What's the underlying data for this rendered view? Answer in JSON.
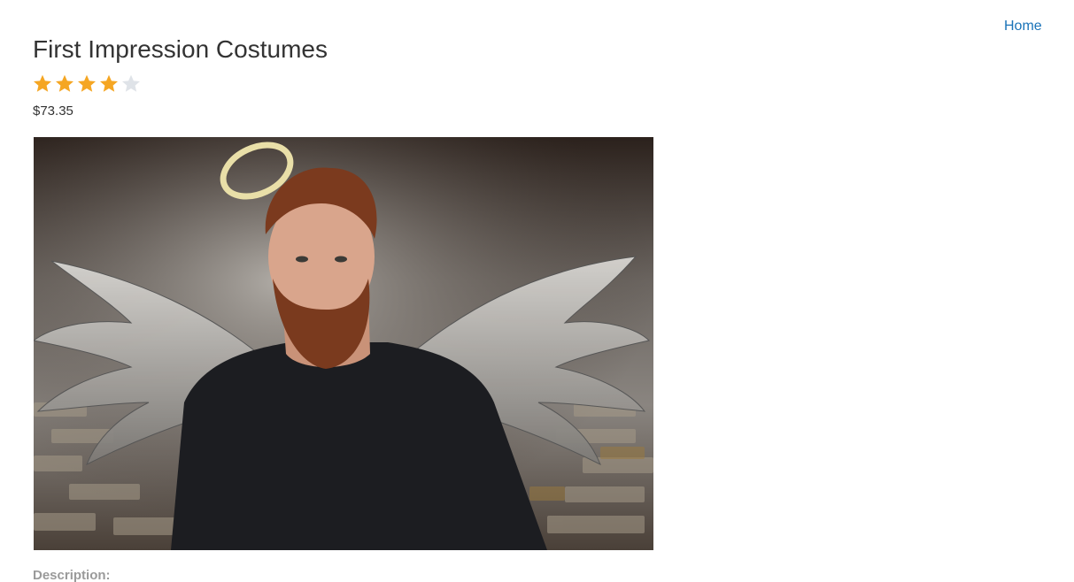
{
  "nav": {
    "home_label": "Home"
  },
  "product": {
    "title": "First Impression Costumes",
    "rating": {
      "value": 4,
      "max": 5
    },
    "price": "$73.35",
    "image_icon": "product-photo",
    "description_label": "Description:"
  },
  "colors": {
    "star_filled": "#f5a623",
    "star_empty": "#dfe3e8",
    "link": "#1a73b8"
  }
}
